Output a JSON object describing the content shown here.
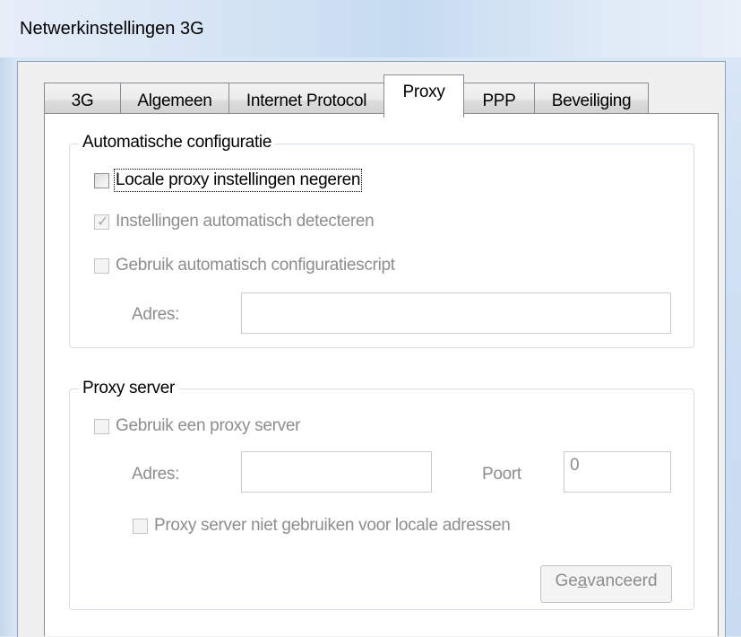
{
  "window": {
    "title": "Netwerkinstellingen 3G"
  },
  "tabs": [
    {
      "label": "3G"
    },
    {
      "label": "Algemeen"
    },
    {
      "label": "Internet Protocol"
    },
    {
      "label": "Proxy",
      "active": true
    },
    {
      "label": "PPP"
    },
    {
      "label": "Beveiliging"
    }
  ],
  "auto_config": {
    "legend": "Automatische configuratie",
    "ignore_local": {
      "label": "Locale proxy instellingen negeren",
      "checked": false,
      "enabled": true
    },
    "auto_detect": {
      "label": "Instellingen automatisch detecteren",
      "checked": true,
      "enabled": false
    },
    "use_script": {
      "label": "Gebruik automatisch configuratiescript",
      "checked": false,
      "enabled": false
    },
    "address_label": "Adres:",
    "address_value": ""
  },
  "proxy_server": {
    "legend": "Proxy server",
    "use_proxy": {
      "label": "Gebruik een proxy server",
      "checked": false,
      "enabled": false
    },
    "address_label": "Adres:",
    "address_value": "",
    "port_label": "Poort",
    "port_value": "0",
    "bypass_local": {
      "label": "Proxy server niet gebruiken voor locale adressen",
      "checked": false,
      "enabled": false
    },
    "advanced_button": {
      "label_pre": "Ge",
      "label_accel": "a",
      "label_post": "vanceerd"
    }
  },
  "colors": {
    "disabled_text": "#8d8d8d",
    "group_border": "#d5dfe5",
    "tab_border": "#898c95"
  }
}
